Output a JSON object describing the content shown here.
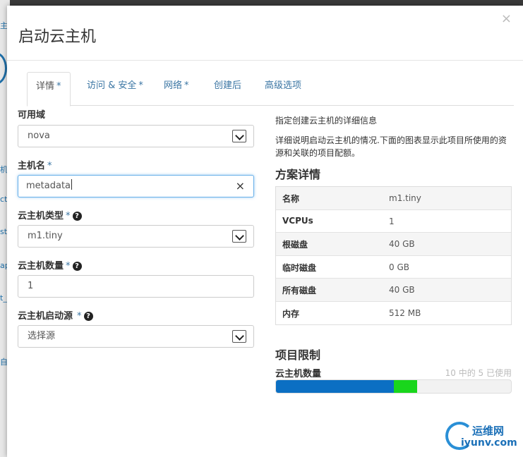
{
  "background": {
    "fragments": [
      "主",
      "机",
      "ct",
      "st",
      "ap",
      "t_",
      "自"
    ]
  },
  "modal": {
    "title": "启动云主机",
    "close": "×"
  },
  "tabs": [
    {
      "label": "详情",
      "required": "*"
    },
    {
      "label": "访问 & 安全",
      "required": "*"
    },
    {
      "label": "网络",
      "required": "*"
    },
    {
      "label": "创建后",
      "required": ""
    },
    {
      "label": "高级选项",
      "required": ""
    }
  ],
  "form": {
    "availability_zone": {
      "label": "可用域",
      "value": "nova"
    },
    "hostname": {
      "label": "主机名",
      "required": "*",
      "value": "metadata",
      "clear": "×"
    },
    "flavor": {
      "label": "云主机类型",
      "required": "*",
      "value": "m1.tiny",
      "help": "?"
    },
    "count": {
      "label": "云主机数量",
      "required": "*",
      "value": "1",
      "help": "?"
    },
    "boot_source": {
      "label": "云主机启动源",
      "required": "*",
      "value": "选择源",
      "help": "?"
    }
  },
  "details": {
    "intro": "指定创建云主机的详细信息",
    "description": "详细说明启动云主机的情况.下面的图表显示此项目所使用的资源和关联的项目配额。",
    "flavor_heading": "方案详情",
    "rows": [
      {
        "key": "名称",
        "value": "m1.tiny"
      },
      {
        "key": "VCPUs",
        "value": "1"
      },
      {
        "key": "根磁盘",
        "value": "40 GB"
      },
      {
        "key": "临时磁盘",
        "value": "0 GB"
      },
      {
        "key": "所有磁盘",
        "value": "40 GB"
      },
      {
        "key": "内存",
        "value": "512 MB"
      }
    ],
    "limits_heading": "项目限制",
    "instance_limit": {
      "label": "云主机数量",
      "usage_text": "10 中的 5 已使用",
      "used_fraction": 0.5,
      "new_fraction": 0.1
    }
  },
  "colors": {
    "accent": "#3a75a3",
    "used": "#0b6fc3",
    "new": "#19d61c"
  },
  "watermark": {
    "line1": "运维网",
    "line2": "iyunv.com"
  }
}
